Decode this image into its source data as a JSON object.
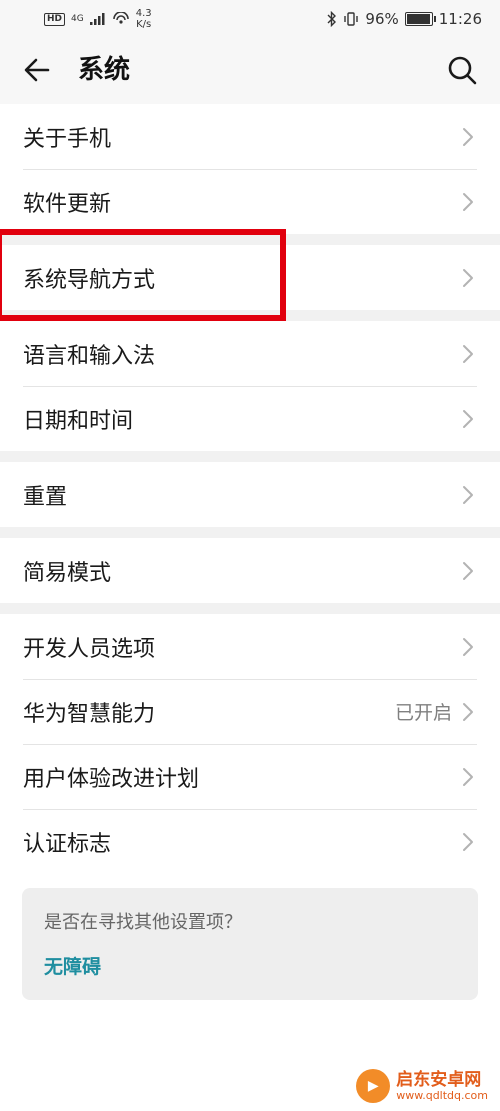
{
  "status_bar": {
    "hd": "HD",
    "network": "4G",
    "speed_value": "4.3",
    "speed_unit": "K/s",
    "battery": "96%",
    "time": "11:26"
  },
  "header": {
    "title": "系统"
  },
  "groups": [
    [
      {
        "label": "关于手机"
      },
      {
        "label": "软件更新"
      }
    ],
    [
      {
        "label": "系统导航方式"
      }
    ],
    [
      {
        "label": "语言和输入法"
      },
      {
        "label": "日期和时间"
      }
    ],
    [
      {
        "label": "重置"
      }
    ],
    [
      {
        "label": "简易模式"
      }
    ],
    [
      {
        "label": "开发人员选项"
      },
      {
        "label": "华为智慧能力",
        "status": "已开启"
      },
      {
        "label": "用户体验改进计划"
      },
      {
        "label": "认证标志"
      }
    ]
  ],
  "suggestion": {
    "question": "是否在寻找其他设置项？",
    "link": "无障碍"
  },
  "watermark": {
    "brand": "启东安卓网",
    "url": "www.qdltdq.com"
  },
  "colors": {
    "highlight": "#e1000e",
    "link": "#1f8ea0",
    "background": "#f1f1f1"
  }
}
